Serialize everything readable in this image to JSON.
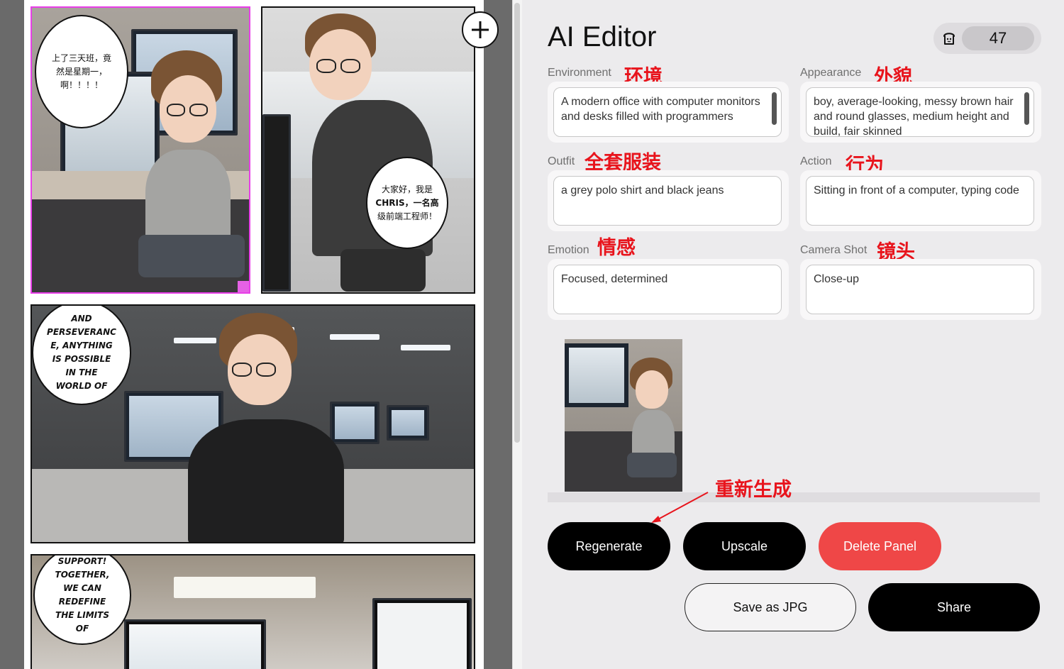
{
  "comic": {
    "panel1_bubble": "上了三天班，竟然是星期一，啊！！！！",
    "panel2_bubble_line1": "大家好，我是",
    "panel2_bubble_line2": "CHRIS，一名高",
    "panel2_bubble_line3": "级前端工程师！",
    "panel3_bubble": "AND PERSEVERANC E, ANYTHING IS POSSIBLE IN THE WORLD OF",
    "panel4_bubble": "SUPPORT! TOGETHER, WE CAN REDEFINE THE LIMITS OF",
    "add_panel_icon": "plus-icon"
  },
  "editor": {
    "title": "AI Editor",
    "credits": {
      "icon": "bread-icon",
      "value": "47"
    },
    "fields": {
      "environment": {
        "label": "Environment",
        "annotation": "环境",
        "value": "A modern office with computer monitors and desks filled with programmers"
      },
      "appearance": {
        "label": "Appearance",
        "annotation": "外貌",
        "value": "boy, average-looking, messy brown hair and round glasses, medium height and build, fair skinned"
      },
      "outfit": {
        "label": "Outfit",
        "annotation": "全套服装",
        "value": "a grey polo shirt and black jeans"
      },
      "action": {
        "label": "Action",
        "annotation": "行为",
        "value": "Sitting in front of a computer, typing code"
      },
      "emotion": {
        "label": "Emotion",
        "annotation": "情感",
        "value": "Focused, determined"
      },
      "camera_shot": {
        "label": "Camera Shot",
        "annotation": "镜头",
        "value": "Close-up"
      }
    },
    "regenerate_annotation": "重新生成",
    "buttons": {
      "regenerate": "Regenerate",
      "upscale": "Upscale",
      "delete_panel": "Delete Panel",
      "save_jpg": "Save as JPG",
      "share": "Share"
    },
    "colors": {
      "annotation": "#e8141c",
      "delete": "#ef4747",
      "selection": "#e83ee8"
    }
  }
}
